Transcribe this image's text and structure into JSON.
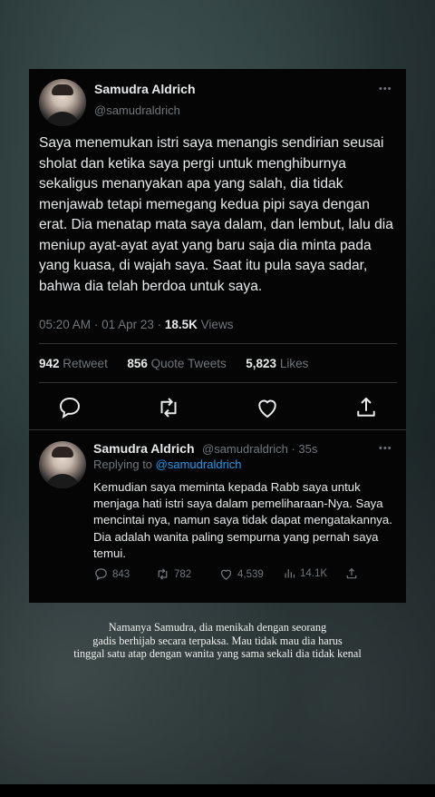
{
  "tweet": {
    "author_name": "Samudra Aldrich",
    "author_handle": "@samudraldrich",
    "more_label": "•••",
    "body": "Saya menemukan istri saya menangis sendirian seusai sholat dan ketika saya pergi untuk menghiburnya sekaligus menanyakan apa yang salah, dia tidak menjawab tetapi memegang kedua pipi saya dengan erat. Dia menatap mata saya dalam, dan lembut, lalu dia meniup ayat-ayat ayat yang baru saja dia minta pada yang kuasa, di wajah saya. Saat itu pula saya sadar, bahwa dia telah berdoa untuk saya.",
    "time": "05:20 AM",
    "date": "01 Apr 23",
    "views_count": "18.5K",
    "views_label": "Views",
    "retweets_count": "942",
    "retweets_label": "Retweet",
    "quotes_count": "856",
    "quotes_label": "Quote Tweets",
    "likes_count": "5,823",
    "likes_label": "Likes",
    "actions": [
      "comment-icon",
      "retweet-icon",
      "heart-icon",
      "share-icon"
    ]
  },
  "reply": {
    "author_name": "Samudra Aldrich",
    "author_handle": "@samudraldrich",
    "age": "35s",
    "more_label": "•••",
    "replying_prefix": "Replying to",
    "replying_to": "@samudraldrich",
    "body": "Kemudian saya meminta kepada Rabb saya untuk menjaga hati istri saya dalam pemeliharaan-Nya. Saya mencintai nya, namun saya tidak dapat mengatakannya. Dia  adalah wanita paling sempurna yang pernah saya temui.",
    "comments": "843",
    "retweets": "782",
    "likes": "4,539",
    "views": "14.1K"
  },
  "caption": {
    "line1": "Namanya Samudra, dia menikah dengan seorang",
    "line2": "gadis berhijab secara terpaksa. Mau tidak mau dia harus",
    "line3": "tinggal satu atap dengan wanita yang sama sekali dia tidak kenal"
  },
  "colors": {
    "card_bg": "#050505",
    "text": "#e7e9ea",
    "muted": "#71767b",
    "link": "#1d9bf0"
  }
}
